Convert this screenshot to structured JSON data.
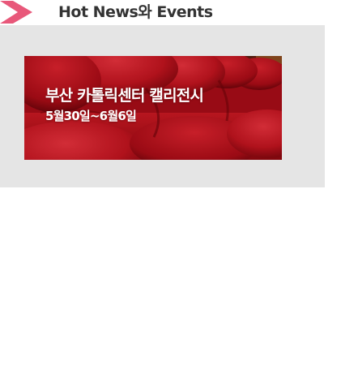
{
  "section": {
    "icon": "chevron-right-icon",
    "title": "Hot News와 Events",
    "accent_color": "#e8587a",
    "panel_color": "#e5e5e5"
  },
  "banner": {
    "title": "부산 카톨릭센터 캘리전시",
    "dates": "5월30일~6월6일",
    "background_color": "#b5111a"
  }
}
